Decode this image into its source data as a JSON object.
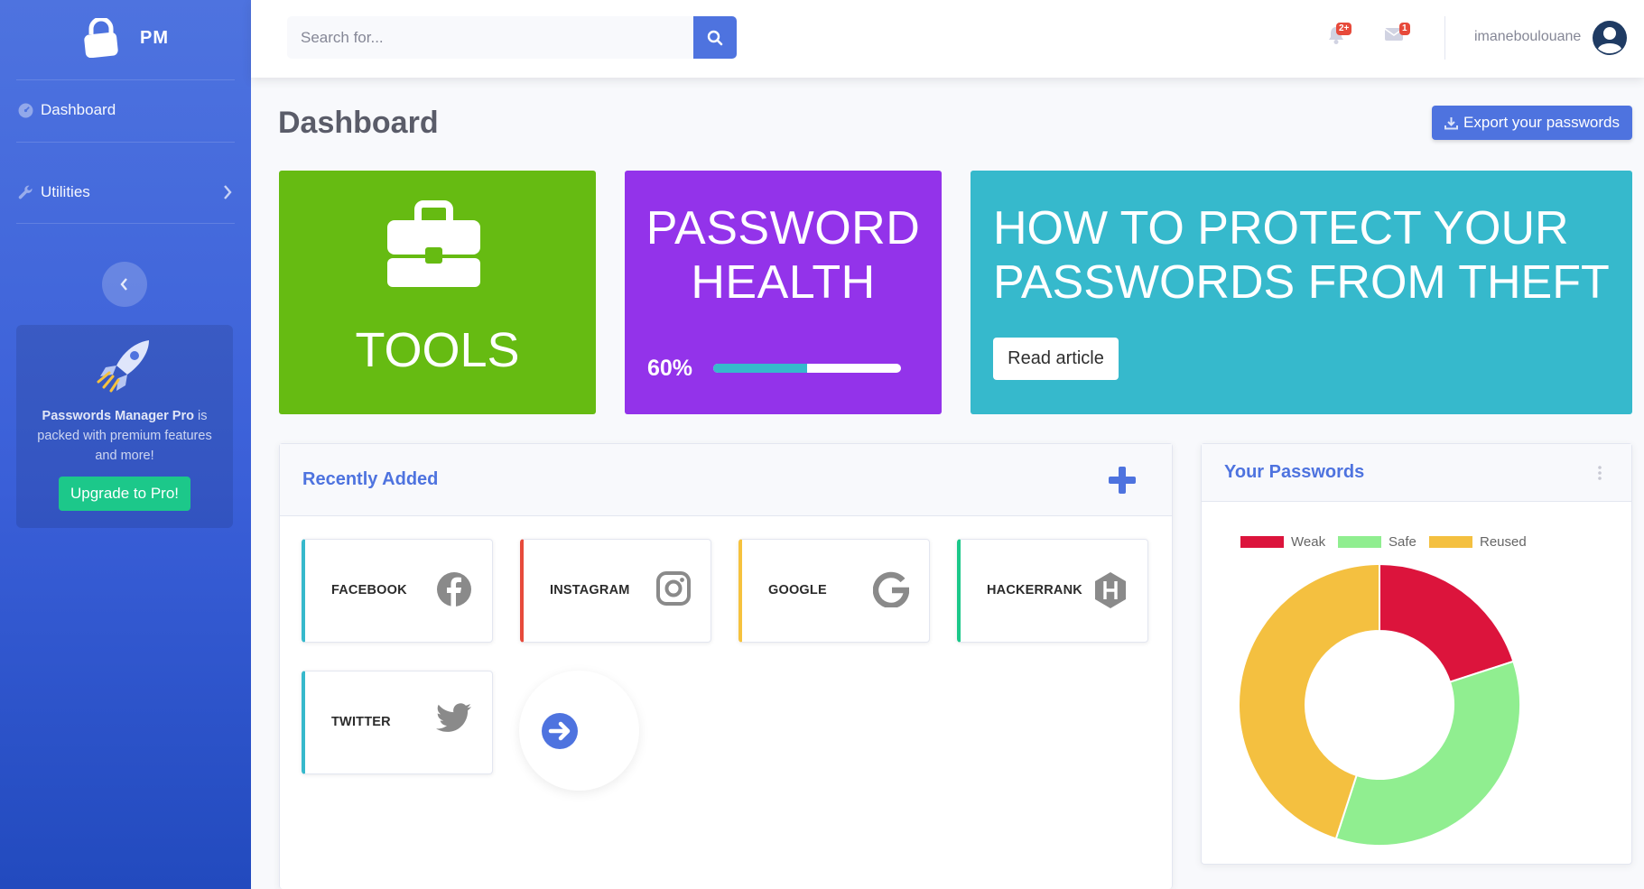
{
  "brand": {
    "name": "PM"
  },
  "sidebar": {
    "items": [
      {
        "label": "Dashboard",
        "icon": "tachometer-icon"
      },
      {
        "label": "Utilities",
        "icon": "wrench-icon"
      }
    ],
    "promo": {
      "text_bold": "Passwords Manager Pro",
      "text_rest": " is packed with premium features and more!",
      "button": "Upgrade to Pro!"
    }
  },
  "topbar": {
    "search_placeholder": "Search for...",
    "alerts_badge": "2+",
    "messages_badge": "1",
    "username": "imaneboulouane"
  },
  "page": {
    "title": "Dashboard",
    "export_button": "Export your passwords"
  },
  "cards": {
    "tools": {
      "label": "TOOLS",
      "color": "#66bb12"
    },
    "health": {
      "title_line1": "PASSWORD",
      "title_line2": "HEALTH",
      "percent_text": "60%",
      "bar_fill": 0.5,
      "color": "#9333ea"
    },
    "article": {
      "title_line1": "HOW TO PROTECT YOUR",
      "title_line2": "PASSWORDS FROM THEFT",
      "button": "Read article",
      "color": "#36b9cc"
    }
  },
  "recent": {
    "title": "Recently Added",
    "items": [
      {
        "label": "FACEBOOK",
        "accent": "#36b9cc",
        "icon": "facebook-icon"
      },
      {
        "label": "INSTAGRAM",
        "accent": "#e74a3b",
        "icon": "instagram-icon"
      },
      {
        "label": "GOOGLE",
        "accent": "#f6c23e",
        "icon": "google-icon"
      },
      {
        "label": "HACKERRANK",
        "accent": "#1cc88a",
        "icon": "hackerrank-icon"
      },
      {
        "label": "TWITTER",
        "accent": "#36b9cc",
        "icon": "twitter-icon"
      }
    ]
  },
  "passwords_chart": {
    "title": "Your Passwords"
  },
  "chart_data": {
    "type": "pie",
    "categories": [
      "Weak",
      "Safe",
      "Reused"
    ],
    "values": [
      20,
      35,
      45
    ],
    "colors": [
      "#dc143c",
      "#90ee90",
      "#f4c040"
    ],
    "legend": "top",
    "donut": true
  }
}
